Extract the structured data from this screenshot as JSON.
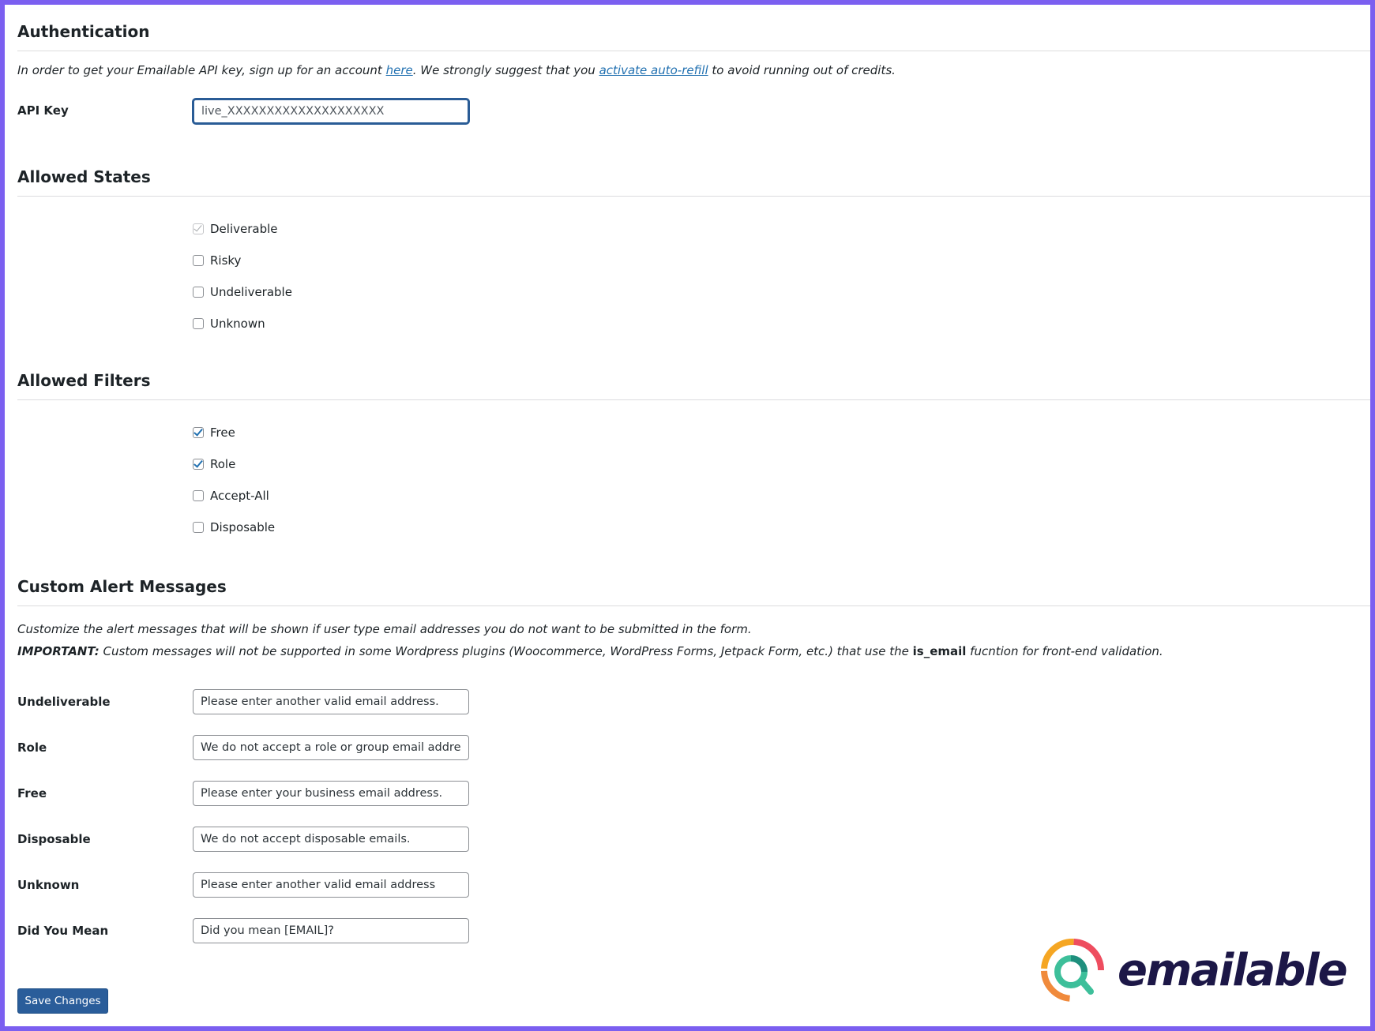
{
  "authentication": {
    "title": "Authentication",
    "desc_prefix": "In order to get your Emailable API key, sign up for an account ",
    "desc_link1": "here",
    "desc_middle": ". We strongly suggest that you ",
    "desc_link2": "activate auto-refill",
    "desc_suffix": " to avoid running out of credits.",
    "api_key_label": "API Key",
    "api_key_value": "live_XXXXXXXXXXXXXXXXXXXX"
  },
  "allowed_states": {
    "title": "Allowed States",
    "items": [
      {
        "label": "Deliverable",
        "checked": true,
        "disabled": true
      },
      {
        "label": "Risky",
        "checked": false,
        "disabled": false
      },
      {
        "label": "Undeliverable",
        "checked": false,
        "disabled": false
      },
      {
        "label": "Unknown",
        "checked": false,
        "disabled": false
      }
    ]
  },
  "allowed_filters": {
    "title": "Allowed Filters",
    "items": [
      {
        "label": "Free",
        "checked": true
      },
      {
        "label": "Role",
        "checked": true
      },
      {
        "label": "Accept-All",
        "checked": false
      },
      {
        "label": "Disposable",
        "checked": false
      }
    ]
  },
  "custom_alerts": {
    "title": "Custom Alert Messages",
    "desc1": "Customize the alert messages that will be shown if user type email addresses you do not want to be submitted in the form.",
    "desc2_bold": "IMPORTANT:",
    "desc2_middle": " Custom messages will not be supported in some Wordpress plugins (Woocommerce, WordPress Forms, Jetpack Form, etc.) that use the ",
    "desc2_code": "is_email",
    "desc2_suffix": " fucntion for front-end validation.",
    "fields": [
      {
        "label": "Undeliverable",
        "value": "Please enter another valid email address."
      },
      {
        "label": "Role",
        "value": "We do not accept a role or group email address."
      },
      {
        "label": "Free",
        "value": "Please enter your business email address."
      },
      {
        "label": "Disposable",
        "value": "We do not accept disposable emails."
      },
      {
        "label": "Unknown",
        "value": "Please enter another valid email address"
      },
      {
        "label": "Did You Mean",
        "value": "Did you mean [EMAIL]?"
      }
    ]
  },
  "save_button_label": "Save Changes",
  "logo": {
    "text": "emailable",
    "icon": "emailable-logo-icon"
  },
  "colors": {
    "frame": "#7B5FF0",
    "link": "#2271b1",
    "button": "#2a5d9a",
    "brand_text": "#1c1747"
  }
}
